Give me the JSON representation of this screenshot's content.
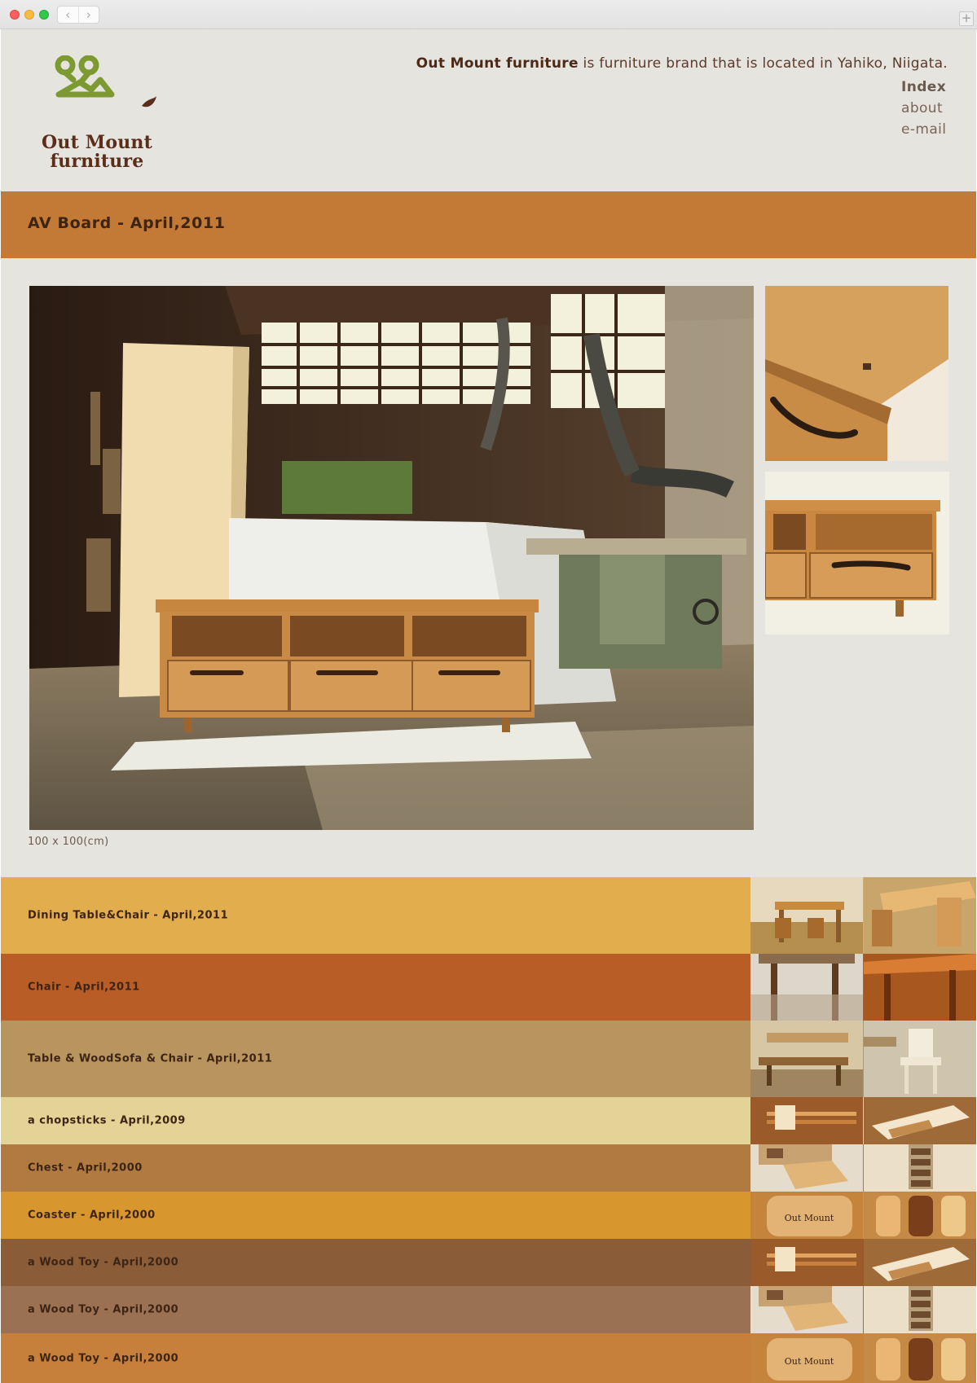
{
  "browser": {
    "back_icon": "chevron-left-icon",
    "forward_icon": "chevron-right-icon",
    "new_tab_label": "+"
  },
  "header": {
    "logo": {
      "line1": "Out Mount",
      "line2": "furniture",
      "icon": "mountain-logo-icon",
      "color": "#7d9a32"
    },
    "tagline": {
      "brand": "Out Mount furniture",
      "rest": " is furniture brand that is located in Yahiko, Niigata."
    },
    "nav": [
      {
        "label": "Index",
        "active": true
      },
      {
        "label": "about",
        "active": false
      },
      {
        "label": "e-mail",
        "active": false
      }
    ]
  },
  "feature": {
    "title": "AV Board - April,2011",
    "caption": "100 x 100(cm)",
    "band_color": "#c37a36"
  },
  "list": [
    {
      "label": "Dining Table&Chair - April,2011",
      "color": "#e1ad4d"
    },
    {
      "label": "Chair - April,2011",
      "color": "#b95d27"
    },
    {
      "label": "Table & WoodSofa & Chair - April,2011",
      "color": "#b8945f"
    },
    {
      "label": "a chopsticks - April,2009",
      "color": "#e3d396"
    },
    {
      "label": "Chest - April,2000",
      "color": "#b17a40"
    },
    {
      "label": "Coaster - April,2000",
      "color": "#d8962f"
    },
    {
      "label": "a Wood Toy - April,2000",
      "color": "#8a5c37"
    },
    {
      "label": "a Wood Toy - April,2000",
      "color": "#9a7152"
    },
    {
      "label": "a Wood Toy - April,2000",
      "color": "#c6803b"
    }
  ]
}
